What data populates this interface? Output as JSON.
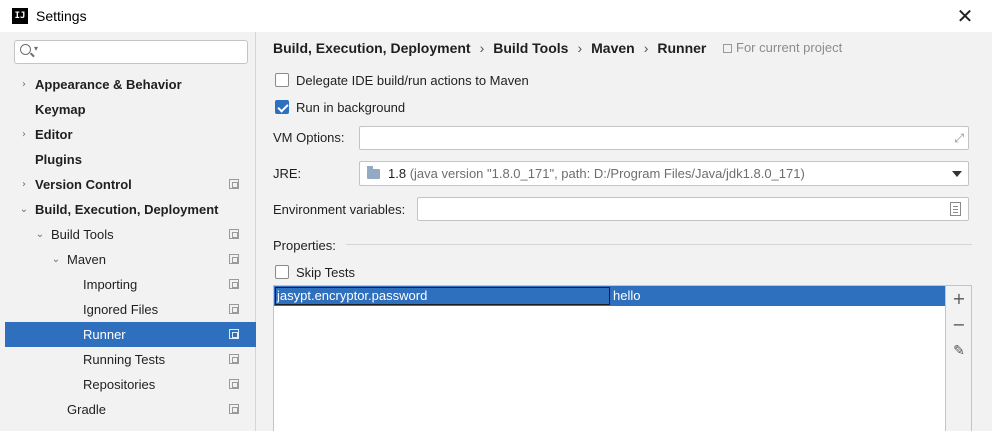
{
  "window": {
    "title": "Settings",
    "app_icon": "IJ",
    "close_glyph": "✕"
  },
  "search": {
    "value": "",
    "placeholder": ""
  },
  "tree": [
    {
      "label": "Appearance & Behavior",
      "bold": true,
      "arrow": "›",
      "indent": 0,
      "project": false
    },
    {
      "label": "Keymap",
      "bold": true,
      "arrow": "",
      "indent": 0,
      "project": false
    },
    {
      "label": "Editor",
      "bold": true,
      "arrow": "›",
      "indent": 0,
      "project": false
    },
    {
      "label": "Plugins",
      "bold": true,
      "arrow": "",
      "indent": 0,
      "project": false
    },
    {
      "label": "Version Control",
      "bold": true,
      "arrow": "›",
      "indent": 0,
      "project": true
    },
    {
      "label": "Build, Execution, Deployment",
      "bold": true,
      "arrow": "⌄",
      "indent": 0,
      "project": false
    },
    {
      "label": "Build Tools",
      "bold": false,
      "arrow": "⌄",
      "indent": 1,
      "project": true
    },
    {
      "label": "Maven",
      "bold": false,
      "arrow": "⌄",
      "indent": 2,
      "project": true
    },
    {
      "label": "Importing",
      "bold": false,
      "arrow": "",
      "indent": 3,
      "project": true
    },
    {
      "label": "Ignored Files",
      "bold": false,
      "arrow": "",
      "indent": 3,
      "project": true
    },
    {
      "label": "Runner",
      "bold": false,
      "arrow": "",
      "indent": 3,
      "project": true,
      "selected": true
    },
    {
      "label": "Running Tests",
      "bold": false,
      "arrow": "",
      "indent": 3,
      "project": true
    },
    {
      "label": "Repositories",
      "bold": false,
      "arrow": "",
      "indent": 3,
      "project": true
    },
    {
      "label": "Gradle",
      "bold": false,
      "arrow": "",
      "indent": 2,
      "project": true
    }
  ],
  "breadcrumb": [
    "Build, Execution, Deployment",
    "Build Tools",
    "Maven",
    "Runner"
  ],
  "breadcrumb_sep": "›",
  "for_current_project": "For current project",
  "options": {
    "delegate": {
      "label": "Delegate IDE build/run actions to Maven",
      "checked": false
    },
    "background": {
      "label": "Run in background",
      "checked": true
    }
  },
  "vm_options": {
    "label": "VM Options:",
    "value": ""
  },
  "jre": {
    "label": "JRE:",
    "version": "1.8",
    "detail": "(java version \"1.8.0_171\", path: D:/Program Files/Java/jdk1.8.0_171)"
  },
  "env_vars": {
    "label": "Environment variables:",
    "value": ""
  },
  "properties": {
    "label": "Properties:",
    "skip_tests": {
      "label": "Skip Tests",
      "checked": false
    },
    "rows": [
      {
        "key": "jasypt.encryptor.password",
        "value": "hello"
      }
    ]
  },
  "toolbar": {
    "add": "+",
    "remove": "−",
    "edit": "✎"
  },
  "colors": {
    "selection": "#2e6fbe",
    "background": "#f2f2f2"
  }
}
